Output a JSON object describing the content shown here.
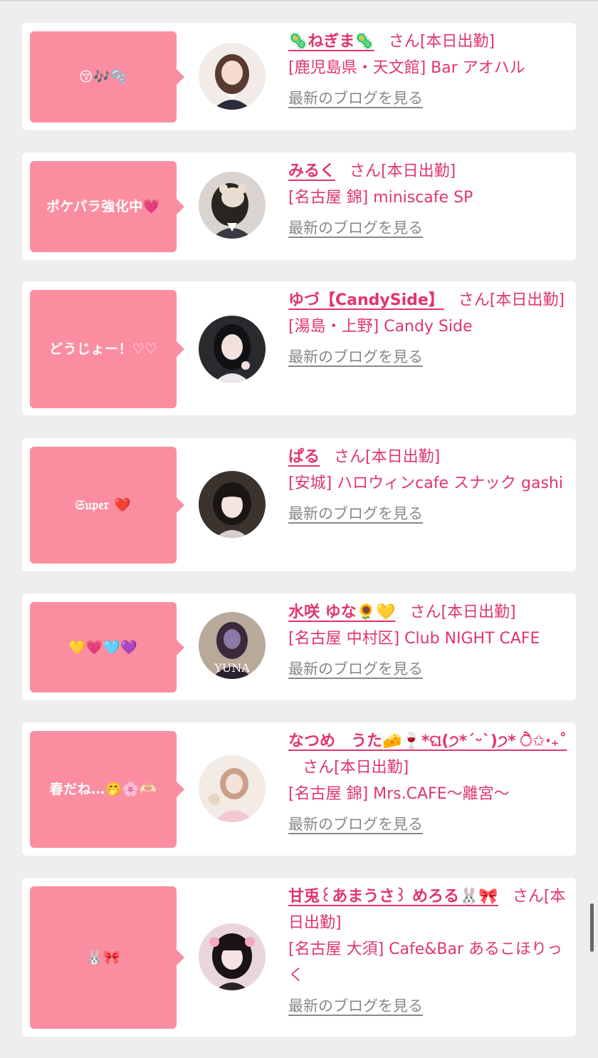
{
  "honorific": "さん",
  "blog_link_label": "最新のブログを見る",
  "entries": [
    {
      "message": "😚🎶🫧",
      "name": "🦠ねぎま🦠",
      "status": "[本日出勤]",
      "shop": "[鹿児島県・天文館] Bar アオハル",
      "avatar_bg": "#f2ece8",
      "avatar_hair": "#5a3a30"
    },
    {
      "message": "ポケパラ強化中💗",
      "name": "みるく",
      "status": "[本日出勤]",
      "shop": "[名古屋 錦] miniscafe SP",
      "avatar_bg": "#d9d4d0",
      "avatar_hair": "#2a2420"
    },
    {
      "message": "どうじょー！♡♡",
      "name": "ゆづ【CandySide】",
      "status": "[本日出勤]",
      "shop": "[湯島・上野] Candy Side",
      "avatar_bg": "#2a2a2e",
      "avatar_hair": "#111114"
    },
    {
      "message": "𝔖𝔲𝔭𝔢𝔯 ❤️",
      "name": "ぱる",
      "status": "[本日出勤]",
      "shop": "[安城] ハロウィンcafe スナック gashi",
      "avatar_bg": "#3a332e",
      "avatar_hair": "#1c1612"
    },
    {
      "message": "💛💗🩵💜",
      "name": "水咲 ゆな🌻💛",
      "status": "[本日出勤]",
      "shop": "[名古屋 中村区] Club NIGHT CAFE",
      "avatar_bg": "#b9a99a",
      "avatar_hair": "#3b2a3a",
      "avatar_caption": "YUNA"
    },
    {
      "message": "春だね…🤭🌸🫶🏻",
      "name": "なつめ　うた🧀🍷*ଘ(੭*ˊᵕˋ)੭* ੈ✩‧₊˚",
      "status": "[本日出勤]",
      "shop": "[名古屋 錦] Mrs.CAFE～離宮～",
      "avatar_bg": "#f3ebe6",
      "avatar_hair": "#c9a08a"
    },
    {
      "message": "🐰🎀",
      "name": "甘兎꒰あまうさ꒱ めろる🐰🎀",
      "status": "[本日出勤]",
      "shop": "[名古屋 大須] Cafe&Bar あるこほりっく",
      "avatar_bg": "#e9d6dc",
      "avatar_hair": "#1a1216"
    }
  ]
}
